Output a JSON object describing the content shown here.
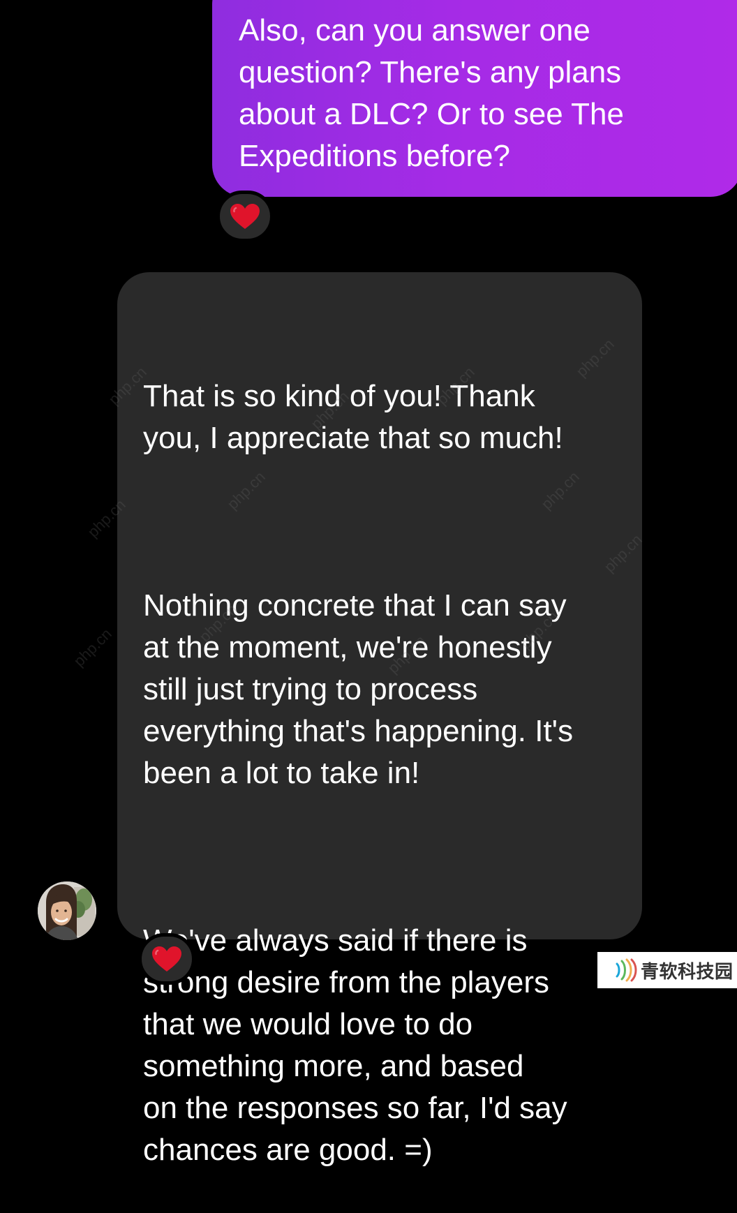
{
  "conversation": {
    "sent_message": {
      "text": "Also, can you answer one\nquestion? There's any plans\nabout a DLC? Or to see The\nExpeditions before?",
      "reaction": "heart-icon"
    },
    "received_message": {
      "paragraph_1": "That is so kind of you! Thank\nyou, I appreciate that so much!",
      "paragraph_2": "Nothing concrete that I can say\nat the moment, we're honestly\nstill just trying to process\neverything that's happening. It's\nbeen a lot to take in!",
      "paragraph_3": "We've always said if there is\nstrong desire from the players\nthat we would love to do\nsomething more, and based\non the responses so far, I'd say\nchances are good. =)",
      "reaction": "heart-icon"
    }
  },
  "watermark": {
    "text": "php.cn"
  },
  "corner_logo": {
    "text": "青软科技园"
  },
  "colors": {
    "background": "#000000",
    "sent_bubble_start": "#8f2ddf",
    "sent_bubble_end": "#b02ae8",
    "received_bubble": "#2a2a2a",
    "reaction_pill": "#2b2b2b",
    "heart": "#e0142b"
  }
}
